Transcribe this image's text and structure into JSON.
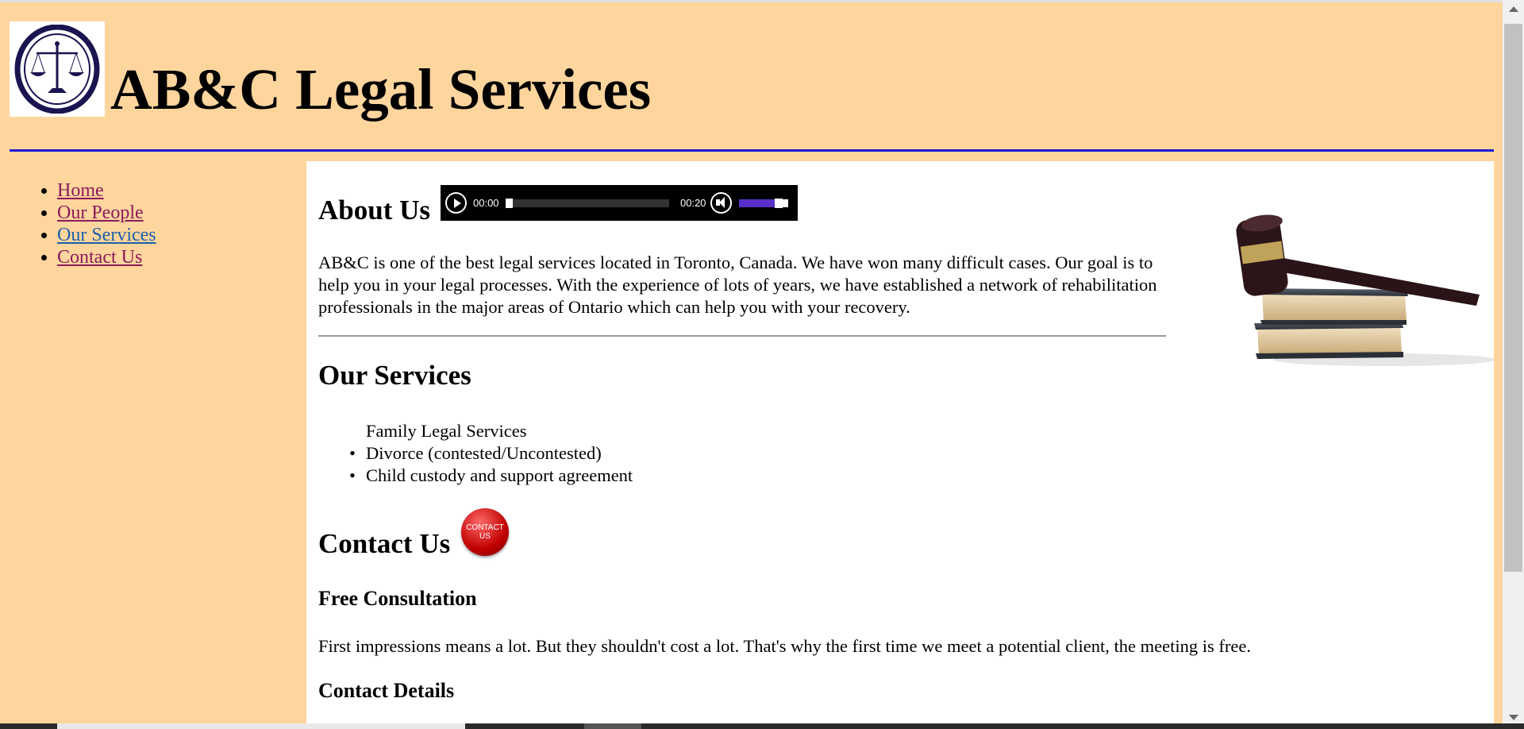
{
  "header": {
    "title": "AB&C Legal Services",
    "logo_icon": "scales-of-justice-icon"
  },
  "nav": {
    "items": [
      "Home",
      "Our People",
      "Our Services",
      "Contact Us"
    ]
  },
  "about": {
    "heading": "About Us",
    "text": "AB&C is one of the best legal services located in Toronto, Canada. We have won many difficult cases. Our goal is to help you in your legal processes. With the experience of lots of years, we have established a network of rehabilitation professionals in the major areas of Ontario which can help you with your recovery."
  },
  "audio": {
    "current_time": "00:00",
    "duration": "00:20",
    "volume_level": 0.8,
    "progress": 0
  },
  "services": {
    "heading": "Our Services",
    "category": "Family Legal Services",
    "items": [
      "Divorce (contested/Uncontested)",
      "Child custody and support agreement"
    ]
  },
  "contact": {
    "heading": "Contact Us",
    "button_label": "CONTACT US",
    "consult_heading": "Free Consultation",
    "consult_text": "First impressions means a lot. But they shouldn't cost a lot. That's why the first time we meet a potential client, the meeting is free.",
    "details_heading": "Contact Details"
  },
  "colors": {
    "page_bg": "#ffd59e",
    "rule": "#1a1ad6",
    "link": "#8b1a5a",
    "volume": "#5a2fc9"
  }
}
